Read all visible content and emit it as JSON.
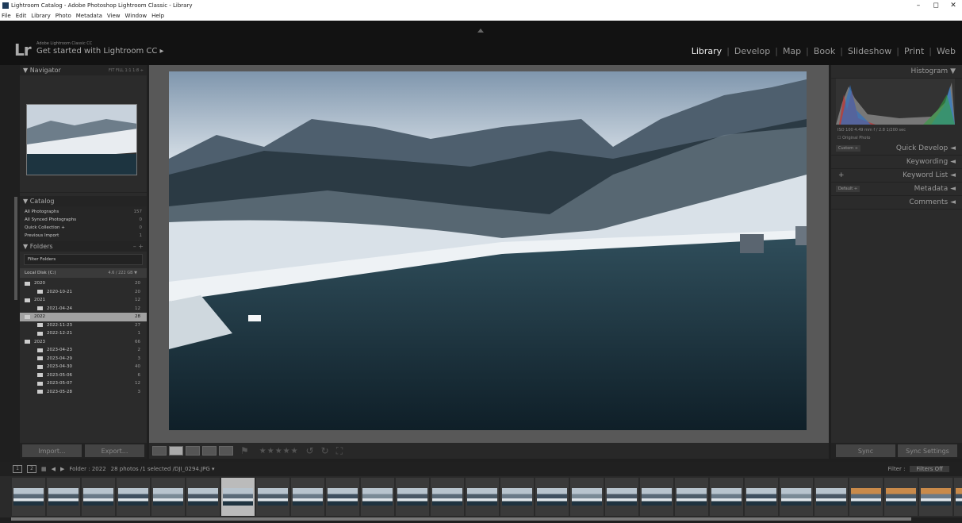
{
  "window": {
    "title": "Lightroom Catalog - Adobe Photoshop Lightroom Classic - Library",
    "controls": [
      "–",
      "◻",
      "✕"
    ]
  },
  "menu": [
    "File",
    "Edit",
    "Library",
    "Photo",
    "Metadata",
    "View",
    "Window",
    "Help"
  ],
  "identity": {
    "logo": "Lr",
    "small": "Adobe Lightroom Classic CC",
    "big": "Get started with Lightroom CC ▸"
  },
  "modules": [
    "Library",
    "Develop",
    "Map",
    "Book",
    "Slideshow",
    "Print",
    "Web"
  ],
  "left": {
    "navigator": {
      "label": "▼ Navigator",
      "zoom": "FIT  FILL  1:1  1:8 ÷"
    },
    "catalog": {
      "label": "▼ Catalog",
      "items": [
        {
          "label": "All Photographs",
          "count": "157"
        },
        {
          "label": "All Synced Photographs",
          "count": "0"
        },
        {
          "label": "Quick Collection +",
          "count": "0"
        },
        {
          "label": "Previous Import",
          "count": "1"
        }
      ]
    },
    "folders": {
      "label": "▼ Folders",
      "action": "– +",
      "filter": "Filter Folders",
      "disk": "Local Disk (C:)",
      "disk_size": "4.6 / 222 GB ▼",
      "items": [
        {
          "label": "2020",
          "count": "20",
          "indent": 6,
          "sel": false
        },
        {
          "label": "2020-10-21",
          "count": "20",
          "indent": 22,
          "sel": false
        },
        {
          "label": "2021",
          "count": "12",
          "indent": 6,
          "sel": false
        },
        {
          "label": "2021-04-24",
          "count": "12",
          "indent": 22,
          "sel": false
        },
        {
          "label": "2022",
          "count": "28",
          "indent": 6,
          "sel": true
        },
        {
          "label": "2022-11-23",
          "count": "27",
          "indent": 22,
          "sel": false
        },
        {
          "label": "2022-12-21",
          "count": "1",
          "indent": 22,
          "sel": false
        },
        {
          "label": "2023",
          "count": "66",
          "indent": 6,
          "sel": false
        },
        {
          "label": "2023-04-23",
          "count": "2",
          "indent": 22,
          "sel": false
        },
        {
          "label": "2023-04-29",
          "count": "3",
          "indent": 22,
          "sel": false
        },
        {
          "label": "2023-04-30",
          "count": "40",
          "indent": 22,
          "sel": false
        },
        {
          "label": "2023-05-06",
          "count": "6",
          "indent": 22,
          "sel": false
        },
        {
          "label": "2023-05-07",
          "count": "12",
          "indent": 22,
          "sel": false
        },
        {
          "label": "2023-05-28",
          "count": "3",
          "indent": 22,
          "sel": false
        }
      ]
    },
    "import": "Import...",
    "export": "Export..."
  },
  "right": {
    "histogram": "Histogram ▼",
    "hist_info": "ISO 100    4.49 mm    f / 2.8    1/200 sec",
    "original": "☐ Original Photo",
    "sections": [
      {
        "label": "Quick Develop ◄",
        "left": "Custom  ÷"
      },
      {
        "label": "Keywording ◄",
        "left": ""
      },
      {
        "label": "Keyword List ◄",
        "left": "+"
      },
      {
        "label": "Metadata ◄",
        "left": "Default  ÷"
      },
      {
        "label": "Comments ◄",
        "left": ""
      }
    ],
    "sync": "Sync",
    "sync_settings": "Sync Settings"
  },
  "filmbar": {
    "folder": "Folder : 2022",
    "info": "28 photos /1 selected /DJI_0294.JPG ▾",
    "filter_label": "Filter :",
    "filter_value": "Filters Off"
  },
  "filmstrip_count": 28,
  "filmstrip_selected": 6
}
